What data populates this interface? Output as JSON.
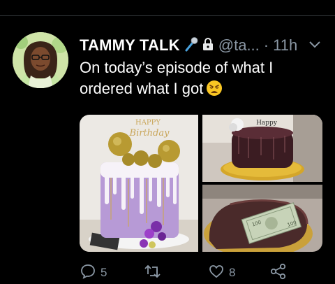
{
  "tweet": {
    "display_name": "TAMMY TALK",
    "handle": "@ta...",
    "separator": "·",
    "time": "11h",
    "text": "On today’s episode of what I ordered what I got",
    "cake_topper": "HAPPY Birthday",
    "icons": [
      "microphone-icon",
      "lock-icon",
      "chevron-down-icon",
      "weary-face-emoji",
      "reply-icon",
      "retweet-icon",
      "like-icon",
      "share-icon"
    ],
    "actions": {
      "reply_count": "5",
      "like_count": "8"
    }
  },
  "colors": {
    "background": "#000000",
    "muted": "#8b98a5",
    "text": "#ffffff"
  }
}
